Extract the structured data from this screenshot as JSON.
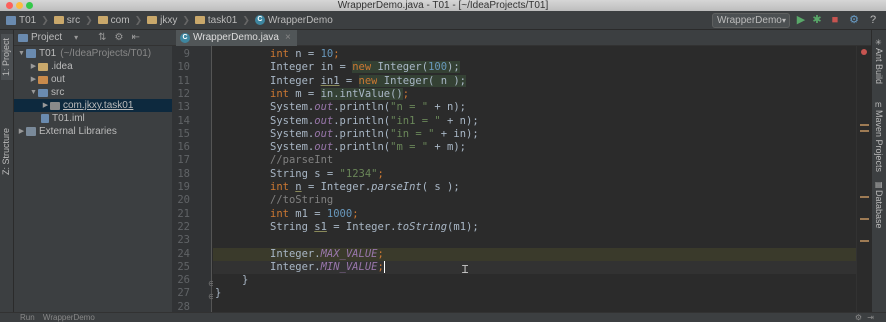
{
  "window": {
    "title": "WrapperDemo.java - T01 - [~/IdeaProjects/T01]"
  },
  "breadcrumbs": [
    "T01",
    "src",
    "com",
    "jkxy",
    "task01",
    "WrapperDemo"
  ],
  "run_config": "WrapperDemo",
  "left_tabs": {
    "project": "1: Project",
    "structure": "Z: Structure"
  },
  "right_tabs": {
    "ant": "Ant Build",
    "maven": "Maven Projects",
    "database": "Database"
  },
  "project_panel": {
    "view": "Project",
    "tree": [
      {
        "label": "T01",
        "hint": "(~/IdeaProjects/T01)"
      },
      {
        "label": ".idea"
      },
      {
        "label": "out"
      },
      {
        "label": "src"
      },
      {
        "label": "com.jkxy.task01"
      },
      {
        "label": "T01.iml"
      },
      {
        "label": "External Libraries"
      }
    ]
  },
  "editor": {
    "tab_label": "WrapperDemo.java",
    "tab_close": "×",
    "lines": [
      {
        "n": "9"
      },
      {
        "n": "10"
      },
      {
        "n": "11"
      },
      {
        "n": "12"
      },
      {
        "n": "13"
      },
      {
        "n": "14"
      },
      {
        "n": "15"
      },
      {
        "n": "16"
      },
      {
        "n": "17"
      },
      {
        "n": "18"
      },
      {
        "n": "19"
      },
      {
        "n": "20"
      },
      {
        "n": "21"
      },
      {
        "n": "22"
      },
      {
        "n": "23"
      },
      {
        "n": "24"
      },
      {
        "n": "25"
      },
      {
        "n": "26"
      },
      {
        "n": "27"
      },
      {
        "n": "28"
      }
    ],
    "tokens": {
      "l9": [
        "int",
        " n = ",
        "10",
        ";"
      ],
      "l10": [
        "Integer in = ",
        "new",
        " Integer(",
        "100",
        ");"
      ],
      "l11": [
        "Integer ",
        "in1",
        " = ",
        "new",
        " Integer( n );"
      ],
      "l12": [
        "int",
        " m = ",
        "in.intValue()",
        ";"
      ],
      "l13": [
        "System.",
        "out",
        ".println(",
        "\"n = \"",
        " + n);"
      ],
      "l14": [
        "System.",
        "out",
        ".println(",
        "\"in1 = \"",
        " + n);"
      ],
      "l15": [
        "System.",
        "out",
        ".println(",
        "\"in = \"",
        " + in);"
      ],
      "l16": [
        "System.",
        "out",
        ".println(",
        "\"m = \"",
        " + m);"
      ],
      "l17": [
        "//parseInt"
      ],
      "l18": [
        "String s = ",
        "\"1234\"",
        ";"
      ],
      "l19": [
        "int",
        " ",
        "n",
        " = Integer.",
        "parseInt",
        "( s );"
      ],
      "l20": [
        "//toString"
      ],
      "l21": [
        "int",
        " m1 = ",
        "1000",
        ";"
      ],
      "l22": [
        "String ",
        "s1",
        " = Integer.",
        "toString",
        "(m1);"
      ],
      "l24": [
        "Integer.",
        "MAX_VALUE",
        ";"
      ],
      "l25": [
        "Integer.",
        "MIN_VALUE",
        ";"
      ],
      "l26": [
        "}"
      ],
      "l27": [
        "}"
      ]
    }
  },
  "status": {
    "run_label": "Run",
    "run_target": "WrapperDemo"
  },
  "colors": {
    "keyword": "#cc7832",
    "number": "#6897bb",
    "string": "#6a8759",
    "comment": "#808080",
    "field": "#9876aa",
    "text": "#a9b7c6"
  }
}
